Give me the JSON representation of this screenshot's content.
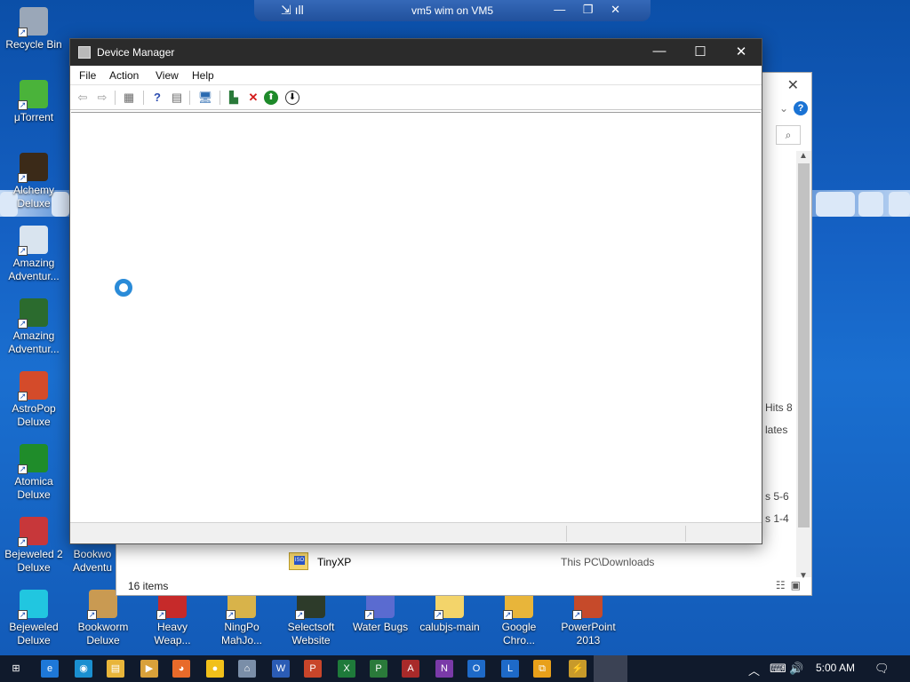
{
  "desktop": {
    "left_icons": [
      {
        "label": "Recycle Bin",
        "color": "#9aa7b8",
        "icon": "recycle-bin-icon"
      },
      {
        "label": "μTorrent",
        "color": "#4ab33a",
        "icon": "utorrent-icon"
      },
      {
        "label": "Alchemy Deluxe",
        "color": "#3b2a18",
        "icon": "alchemy-icon"
      },
      {
        "label": "Amazing Adventur...",
        "color": "#d9e4ef",
        "icon": "amazing-adventures-icon"
      },
      {
        "label": "Amazing Adventur...",
        "color": "#2b6b2e",
        "icon": "amazing-adventures-2-icon"
      },
      {
        "label": "AstroPop Deluxe",
        "color": "#d44b2a",
        "icon": "astropop-icon"
      },
      {
        "label": "Atomica Deluxe",
        "color": "#1f8c2a",
        "icon": "atomica-icon"
      },
      {
        "label": "Bejeweled 2 Deluxe",
        "color": "#c7373a",
        "icon": "bejeweled2-icon"
      },
      {
        "label": "Bejeweled Deluxe",
        "color": "#21c6e0",
        "icon": "bejeweled-icon"
      }
    ],
    "partial_icon": {
      "label": "Bookwo Adventu",
      "color": "#c99a52"
    },
    "bottom_icons": [
      {
        "label": "Bookworm Deluxe",
        "color": "#c99a52",
        "icon": "bookworm-icon"
      },
      {
        "label": "Heavy Weap...",
        "color": "#c62a2a",
        "icon": "heavy-weapon-icon"
      },
      {
        "label": "NingPo MahJo...",
        "color": "#d8b34a",
        "icon": "ningpo-mahjong-icon"
      },
      {
        "label": "Selectsoft Website",
        "color": "#2d3b2a",
        "icon": "selectsoft-icon"
      },
      {
        "label": "Water Bugs",
        "color": "#5a6bd0",
        "icon": "water-bugs-icon"
      },
      {
        "label": "calubjs-main",
        "color": "#f3d46a",
        "icon": "folder-icon"
      },
      {
        "label": "Google Chro...",
        "color": "#e8b53a",
        "icon": "chrome-icon"
      },
      {
        "label": "PowerPoint 2013",
        "color": "#c64a2a",
        "icon": "powerpoint-icon"
      }
    ]
  },
  "remote_bar": {
    "title": "vm5 wim on VM5",
    "left_glyphs": "⇲ ıll",
    "right_glyphs": "— ❐ ✕"
  },
  "explorer": {
    "side_texts": [
      "Hits 8",
      "lates",
      "s 5-6",
      "s 1-4"
    ],
    "file": {
      "name": "TinyXP",
      "path": "This PC\\Downloads"
    },
    "status": "16 items"
  },
  "device_manager": {
    "title": "Device Manager",
    "menu": [
      "File",
      "Action",
      "View",
      "Help"
    ],
    "controls": {
      "minimize": "—",
      "maximize": "☐",
      "close": "✕"
    }
  },
  "taskbar": {
    "time": "5:00 AM",
    "apps": [
      {
        "label": "⊞",
        "color": "#101a2c",
        "name": "start-icon"
      },
      {
        "label": "e",
        "color": "#1e78d8",
        "name": "edge-icon"
      },
      {
        "label": "◉",
        "color": "#1a8fd0",
        "name": "store-icon"
      },
      {
        "label": "▤",
        "color": "#e8b53a",
        "name": "file-explorer-icon"
      },
      {
        "label": "▶",
        "color": "#d9a13a",
        "name": "media-icon"
      },
      {
        "label": "◕",
        "color": "#e86a2a",
        "name": "firefox-icon"
      },
      {
        "label": "●",
        "color": "#f1c01a",
        "name": "chrome-taskbar-icon"
      },
      {
        "label": "⌂",
        "color": "#7a8ea8",
        "name": "network-icon"
      },
      {
        "label": "W",
        "color": "#2b5cb5",
        "name": "word-icon"
      },
      {
        "label": "P",
        "color": "#c8452a",
        "name": "powerpoint-taskbar-icon"
      },
      {
        "label": "X",
        "color": "#1e7a3a",
        "name": "excel-icon"
      },
      {
        "label": "P",
        "color": "#2a7a3a",
        "name": "project-icon"
      },
      {
        "label": "A",
        "color": "#a82a2a",
        "name": "access-icon"
      },
      {
        "label": "N",
        "color": "#7a3aa8",
        "name": "onenote-icon"
      },
      {
        "label": "O",
        "color": "#1e6ac8",
        "name": "outlook-icon"
      },
      {
        "label": "L",
        "color": "#1e6ac8",
        "name": "lync-icon"
      },
      {
        "label": "⧉",
        "color": "#e8a01a",
        "name": "windows-icon"
      },
      {
        "label": "⚡",
        "color": "#c89a2a",
        "name": "tool-icon"
      }
    ],
    "tray": [
      "︿",
      "⌨",
      "🔊"
    ]
  }
}
